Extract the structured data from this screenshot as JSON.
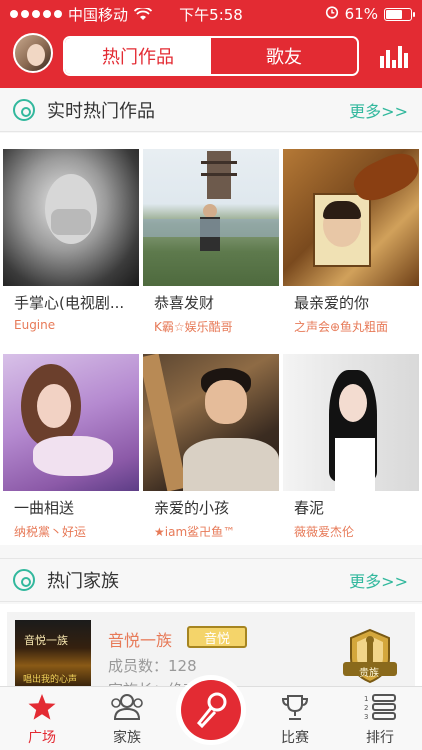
{
  "status_bar": {
    "carrier": "中国移动",
    "time": "下午5:58",
    "battery": "61%",
    "battery_level": 0.61
  },
  "header": {
    "tabs": [
      {
        "label": "热门作品",
        "active": true
      },
      {
        "label": "歌友",
        "active": false
      }
    ]
  },
  "hot_works": {
    "title": "实时热门作品",
    "more_label": "更多>>",
    "items": [
      {
        "title": "手掌心(电视剧...",
        "user": "Eugine"
      },
      {
        "title": "恭喜发财",
        "user": "K霸☆娱乐酷哥"
      },
      {
        "title": "最亲爱的你",
        "user": "之声会⊕鱼丸粗面"
      },
      {
        "title": "一曲相送",
        "user": "纳税黨丶好运"
      },
      {
        "title": "亲爱的小孩",
        "user": "★iam鲨卍鱼™"
      },
      {
        "title": "春泥",
        "user": "薇薇爱杰伦"
      }
    ]
  },
  "hot_family": {
    "title": "热门家族",
    "more_label": "更多>>",
    "item": {
      "name": "音悦一族",
      "badge": "音悦",
      "members": "成员数：128",
      "leader": "家族长：绝恋·一悦",
      "image_text": "音悦一族",
      "image_subtext": "唱出我的心声",
      "crest_text": "贵族"
    }
  },
  "bottom_nav": {
    "items": [
      {
        "label": "广场",
        "active": true,
        "icon": "star-icon"
      },
      {
        "label": "家族",
        "active": false,
        "icon": "people-icon"
      },
      {
        "label": "",
        "active": false,
        "icon": "microphone-icon"
      },
      {
        "label": "比赛",
        "active": false,
        "icon": "trophy-icon"
      },
      {
        "label": "排行",
        "active": false,
        "icon": "ranking-icon"
      }
    ]
  },
  "colors": {
    "brand_red": "#e32b33",
    "accent_green": "#32b89d",
    "user_orange": "#e77a58"
  }
}
